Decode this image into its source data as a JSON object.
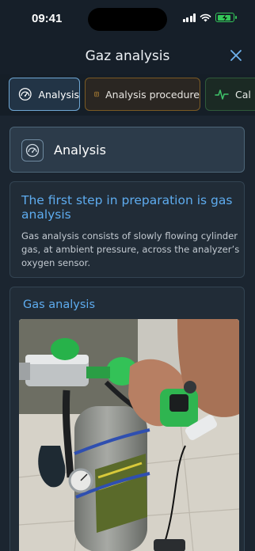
{
  "status_bar": {
    "time": "09:41"
  },
  "header": {
    "title": "Gaz analysis"
  },
  "tabs": [
    {
      "label": "Analysis",
      "icon": "gauge-icon",
      "selected": true,
      "accent": "#6fa7d4"
    },
    {
      "label": "Analysis procedure",
      "icon": "document-icon",
      "selected": false,
      "accent": "#e0a23a"
    },
    {
      "label": "Cal",
      "icon": "pulse-icon",
      "selected": false,
      "accent": "#3fc46a"
    }
  ],
  "section": {
    "title": "Analysis",
    "icon": "gauge-icon"
  },
  "info_card": {
    "heading": "The first step in preparation is gas analysis",
    "body": "Gas analysis consists of slowly flowing cylinder gas, at ambient pressure, across the analyzer’s oxygen sensor."
  },
  "image_card": {
    "title": "Gas analysis",
    "image": "photo-gas-cylinder-with-analyzer"
  },
  "colors": {
    "background": "#1b2530",
    "header": "#161f29",
    "accent_blue": "#5eacef",
    "card": "#212c37"
  }
}
